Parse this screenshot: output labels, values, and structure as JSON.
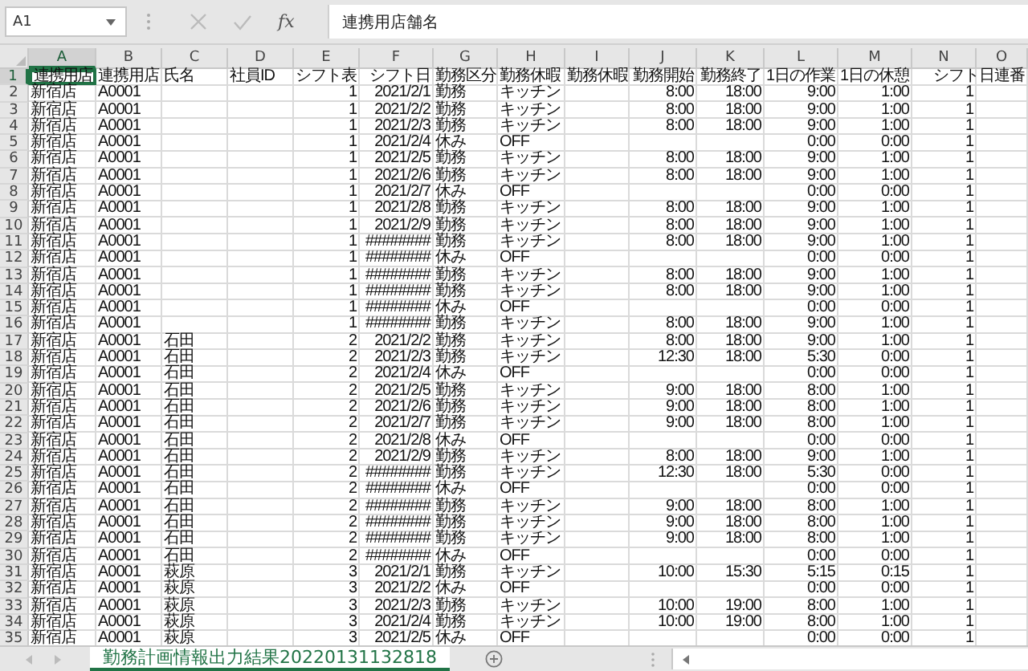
{
  "formula_bar": {
    "name_box": "A1",
    "function_label": "fx",
    "value": "連携用店舗名"
  },
  "sheet": {
    "columns": [
      {
        "label": "A",
        "selected": true,
        "kind": "text"
      },
      {
        "label": "B",
        "selected": false,
        "kind": "text"
      },
      {
        "label": "C",
        "selected": false,
        "kind": "text"
      },
      {
        "label": "D",
        "selected": false,
        "kind": "text"
      },
      {
        "label": "E",
        "selected": false,
        "kind": "number"
      },
      {
        "label": "F",
        "selected": false,
        "kind": "number"
      },
      {
        "label": "G",
        "selected": false,
        "kind": "text"
      },
      {
        "label": "H",
        "selected": false,
        "kind": "text"
      },
      {
        "label": "I",
        "selected": false,
        "kind": "text"
      },
      {
        "label": "J",
        "selected": false,
        "kind": "number"
      },
      {
        "label": "K",
        "selected": false,
        "kind": "number"
      },
      {
        "label": "L",
        "selected": false,
        "kind": "number"
      },
      {
        "label": "M",
        "selected": false,
        "kind": "number"
      },
      {
        "label": "N",
        "selected": false,
        "kind": "number"
      },
      {
        "label": "O",
        "selected": false,
        "kind": "text"
      }
    ],
    "rows": [
      {
        "number": "1",
        "selected": true,
        "kind": "header",
        "cells": [
          "連携用店",
          "連携用店",
          "氏名",
          "社員ID",
          "シフト表",
          "シフト日",
          "勤務区分",
          "勤務休暇",
          "勤務休暇",
          "勤務開始",
          "勤務終了",
          "1日の作業",
          "1日の休憩",
          "シフト日連番",
          null
        ]
      },
      {
        "number": "2",
        "selected": false,
        "kind": "data",
        "cells": [
          "新宿店",
          "A0001",
          null,
          null,
          "1",
          "2021/2/1",
          "勤務",
          "キッチン",
          null,
          "8:00",
          "18:00",
          "9:00",
          "1:00",
          "1",
          null
        ]
      },
      {
        "number": "3",
        "selected": false,
        "kind": "data",
        "cells": [
          "新宿店",
          "A0001",
          null,
          null,
          "1",
          "2021/2/2",
          "勤務",
          "キッチン",
          null,
          "8:00",
          "18:00",
          "9:00",
          "1:00",
          "1",
          null
        ]
      },
      {
        "number": "4",
        "selected": false,
        "kind": "data",
        "cells": [
          "新宿店",
          "A0001",
          null,
          null,
          "1",
          "2021/2/3",
          "勤務",
          "キッチン",
          null,
          "8:00",
          "18:00",
          "9:00",
          "1:00",
          "1",
          null
        ]
      },
      {
        "number": "5",
        "selected": false,
        "kind": "data",
        "cells": [
          "新宿店",
          "A0001",
          null,
          null,
          "1",
          "2021/2/4",
          "休み",
          "OFF",
          null,
          null,
          null,
          "0:00",
          "0:00",
          "1",
          null
        ]
      },
      {
        "number": "6",
        "selected": false,
        "kind": "data",
        "cells": [
          "新宿店",
          "A0001",
          null,
          null,
          "1",
          "2021/2/5",
          "勤務",
          "キッチン",
          null,
          "8:00",
          "18:00",
          "9:00",
          "1:00",
          "1",
          null
        ]
      },
      {
        "number": "7",
        "selected": false,
        "kind": "data",
        "cells": [
          "新宿店",
          "A0001",
          null,
          null,
          "1",
          "2021/2/6",
          "勤務",
          "キッチン",
          null,
          "8:00",
          "18:00",
          "9:00",
          "1:00",
          "1",
          null
        ]
      },
      {
        "number": "8",
        "selected": false,
        "kind": "data",
        "cells": [
          "新宿店",
          "A0001",
          null,
          null,
          "1",
          "2021/2/7",
          "休み",
          "OFF",
          null,
          null,
          null,
          "0:00",
          "0:00",
          "1",
          null
        ]
      },
      {
        "number": "9",
        "selected": false,
        "kind": "data",
        "cells": [
          "新宿店",
          "A0001",
          null,
          null,
          "1",
          "2021/2/8",
          "勤務",
          "キッチン",
          null,
          "8:00",
          "18:00",
          "9:00",
          "1:00",
          "1",
          null
        ]
      },
      {
        "number": "10",
        "selected": false,
        "kind": "data",
        "cells": [
          "新宿店",
          "A0001",
          null,
          null,
          "1",
          "2021/2/9",
          "勤務",
          "キッチン",
          null,
          "8:00",
          "18:00",
          "9:00",
          "1:00",
          "1",
          null
        ]
      },
      {
        "number": "11",
        "selected": false,
        "kind": "data",
        "cells": [
          "新宿店",
          "A0001",
          null,
          null,
          "1",
          "########",
          "勤務",
          "キッチン",
          null,
          "8:00",
          "18:00",
          "9:00",
          "1:00",
          "1",
          null
        ]
      },
      {
        "number": "12",
        "selected": false,
        "kind": "data",
        "cells": [
          "新宿店",
          "A0001",
          null,
          null,
          "1",
          "########",
          "休み",
          "OFF",
          null,
          null,
          null,
          "0:00",
          "0:00",
          "1",
          null
        ]
      },
      {
        "number": "13",
        "selected": false,
        "kind": "data",
        "cells": [
          "新宿店",
          "A0001",
          null,
          null,
          "1",
          "########",
          "勤務",
          "キッチン",
          null,
          "8:00",
          "18:00",
          "9:00",
          "1:00",
          "1",
          null
        ]
      },
      {
        "number": "14",
        "selected": false,
        "kind": "data",
        "cells": [
          "新宿店",
          "A0001",
          null,
          null,
          "1",
          "########",
          "勤務",
          "キッチン",
          null,
          "8:00",
          "18:00",
          "9:00",
          "1:00",
          "1",
          null
        ]
      },
      {
        "number": "15",
        "selected": false,
        "kind": "data",
        "cells": [
          "新宿店",
          "A0001",
          null,
          null,
          "1",
          "########",
          "休み",
          "OFF",
          null,
          null,
          null,
          "0:00",
          "0:00",
          "1",
          null
        ]
      },
      {
        "number": "16",
        "selected": false,
        "kind": "data",
        "cells": [
          "新宿店",
          "A0001",
          null,
          null,
          "1",
          "########",
          "勤務",
          "キッチン",
          null,
          "8:00",
          "18:00",
          "9:00",
          "1:00",
          "1",
          null
        ]
      },
      {
        "number": "17",
        "selected": false,
        "kind": "data",
        "cells": [
          "新宿店",
          "A0001",
          "石田",
          null,
          "2",
          "2021/2/2",
          "勤務",
          "キッチン",
          null,
          "8:00",
          "18:00",
          "9:00",
          "1:00",
          "1",
          null
        ]
      },
      {
        "number": "18",
        "selected": false,
        "kind": "data",
        "cells": [
          "新宿店",
          "A0001",
          "石田",
          null,
          "2",
          "2021/2/3",
          "勤務",
          "キッチン",
          null,
          "12:30",
          "18:00",
          "5:30",
          "0:00",
          "1",
          null
        ]
      },
      {
        "number": "19",
        "selected": false,
        "kind": "data",
        "cells": [
          "新宿店",
          "A0001",
          "石田",
          null,
          "2",
          "2021/2/4",
          "休み",
          "OFF",
          null,
          null,
          null,
          "0:00",
          "0:00",
          "1",
          null
        ]
      },
      {
        "number": "20",
        "selected": false,
        "kind": "data",
        "cells": [
          "新宿店",
          "A0001",
          "石田",
          null,
          "2",
          "2021/2/5",
          "勤務",
          "キッチン",
          null,
          "9:00",
          "18:00",
          "8:00",
          "1:00",
          "1",
          null
        ]
      },
      {
        "number": "21",
        "selected": false,
        "kind": "data",
        "cells": [
          "新宿店",
          "A0001",
          "石田",
          null,
          "2",
          "2021/2/6",
          "勤務",
          "キッチン",
          null,
          "9:00",
          "18:00",
          "8:00",
          "1:00",
          "1",
          null
        ]
      },
      {
        "number": "22",
        "selected": false,
        "kind": "data",
        "cells": [
          "新宿店",
          "A0001",
          "石田",
          null,
          "2",
          "2021/2/7",
          "勤務",
          "キッチン",
          null,
          "9:00",
          "18:00",
          "8:00",
          "1:00",
          "1",
          null
        ]
      },
      {
        "number": "23",
        "selected": false,
        "kind": "data",
        "cells": [
          "新宿店",
          "A0001",
          "石田",
          null,
          "2",
          "2021/2/8",
          "休み",
          "OFF",
          null,
          null,
          null,
          "0:00",
          "0:00",
          "1",
          null
        ]
      },
      {
        "number": "24",
        "selected": false,
        "kind": "data",
        "cells": [
          "新宿店",
          "A0001",
          "石田",
          null,
          "2",
          "2021/2/9",
          "勤務",
          "キッチン",
          null,
          "8:00",
          "18:00",
          "9:00",
          "1:00",
          "1",
          null
        ]
      },
      {
        "number": "25",
        "selected": false,
        "kind": "data",
        "cells": [
          "新宿店",
          "A0001",
          "石田",
          null,
          "2",
          "########",
          "勤務",
          "キッチン",
          null,
          "12:30",
          "18:00",
          "5:30",
          "0:00",
          "1",
          null
        ]
      },
      {
        "number": "26",
        "selected": false,
        "kind": "data",
        "cells": [
          "新宿店",
          "A0001",
          "石田",
          null,
          "2",
          "########",
          "休み",
          "OFF",
          null,
          null,
          null,
          "0:00",
          "0:00",
          "1",
          null
        ]
      },
      {
        "number": "27",
        "selected": false,
        "kind": "data",
        "cells": [
          "新宿店",
          "A0001",
          "石田",
          null,
          "2",
          "########",
          "勤務",
          "キッチン",
          null,
          "9:00",
          "18:00",
          "8:00",
          "1:00",
          "1",
          null
        ]
      },
      {
        "number": "28",
        "selected": false,
        "kind": "data",
        "cells": [
          "新宿店",
          "A0001",
          "石田",
          null,
          "2",
          "########",
          "勤務",
          "キッチン",
          null,
          "9:00",
          "18:00",
          "8:00",
          "1:00",
          "1",
          null
        ]
      },
      {
        "number": "29",
        "selected": false,
        "kind": "data",
        "cells": [
          "新宿店",
          "A0001",
          "石田",
          null,
          "2",
          "########",
          "勤務",
          "キッチン",
          null,
          "9:00",
          "18:00",
          "8:00",
          "1:00",
          "1",
          null
        ]
      },
      {
        "number": "30",
        "selected": false,
        "kind": "data",
        "cells": [
          "新宿店",
          "A0001",
          "石田",
          null,
          "2",
          "########",
          "休み",
          "OFF",
          null,
          null,
          null,
          "0:00",
          "0:00",
          "1",
          null
        ]
      },
      {
        "number": "31",
        "selected": false,
        "kind": "data",
        "cells": [
          "新宿店",
          "A0001",
          "萩原",
          null,
          "3",
          "2021/2/1",
          "勤務",
          "キッチン",
          null,
          "10:00",
          "15:30",
          "5:15",
          "0:15",
          "1",
          null
        ]
      },
      {
        "number": "32",
        "selected": false,
        "kind": "data",
        "cells": [
          "新宿店",
          "A0001",
          "萩原",
          null,
          "3",
          "2021/2/2",
          "休み",
          "OFF",
          null,
          null,
          null,
          "0:00",
          "0:00",
          "1",
          null
        ]
      },
      {
        "number": "33",
        "selected": false,
        "kind": "data",
        "cells": [
          "新宿店",
          "A0001",
          "萩原",
          null,
          "3",
          "2021/2/3",
          "勤務",
          "キッチン",
          null,
          "10:00",
          "19:00",
          "8:00",
          "1:00",
          "1",
          null
        ]
      },
      {
        "number": "34",
        "selected": false,
        "kind": "data",
        "cells": [
          "新宿店",
          "A0001",
          "萩原",
          null,
          "3",
          "2021/2/4",
          "勤務",
          "キッチン",
          null,
          "10:00",
          "19:00",
          "8:00",
          "1:00",
          "1",
          null
        ]
      },
      {
        "number": "35",
        "selected": false,
        "kind": "data",
        "cells": [
          "新宿店",
          "A0001",
          "萩原",
          null,
          "3",
          "2021/2/5",
          "休み",
          "OFF",
          null,
          null,
          null,
          "0:00",
          "0:00",
          "1",
          null
        ]
      }
    ]
  },
  "sheet_tabs": [
    {
      "label": "勤務計画情報出力結果20220131132818",
      "selected": true
    }
  ]
}
